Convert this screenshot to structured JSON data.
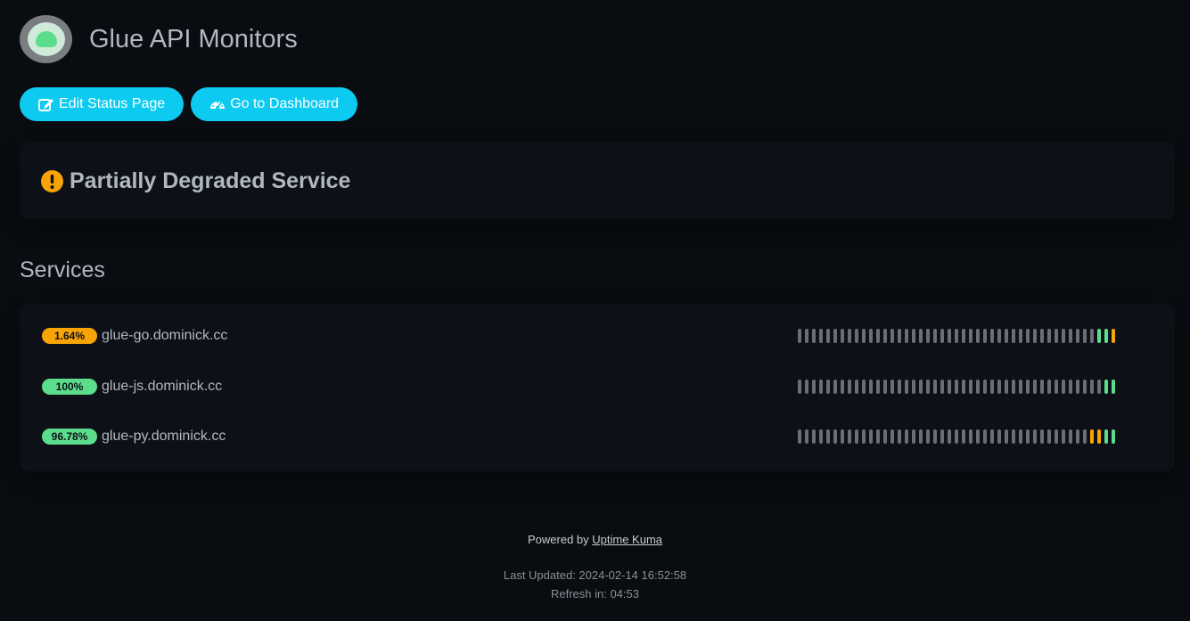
{
  "header": {
    "title": "Glue API Monitors",
    "logo_icon": "uptime-kuma-logo"
  },
  "buttons": {
    "edit_label": "Edit Status Page",
    "dashboard_label": "Go to Dashboard",
    "color": "#0dcaf0"
  },
  "status": {
    "text": "Partially Degraded Service",
    "icon": "exclamation-circle-icon",
    "color": "#f8a306"
  },
  "services": {
    "title": "Services",
    "colors": {
      "up": "#5cdd8b",
      "partial": "#f8a306",
      "empty": "#6a6f75"
    },
    "items": [
      {
        "name": "glue-go.dominick.cc",
        "uptime": "1.64%",
        "badge_color": "#f8a306",
        "beats": [
          "empty",
          "empty",
          "empty",
          "empty",
          "empty",
          "empty",
          "empty",
          "empty",
          "empty",
          "empty",
          "empty",
          "empty",
          "empty",
          "empty",
          "empty",
          "empty",
          "empty",
          "empty",
          "empty",
          "empty",
          "empty",
          "empty",
          "empty",
          "empty",
          "empty",
          "empty",
          "empty",
          "empty",
          "empty",
          "empty",
          "empty",
          "empty",
          "empty",
          "empty",
          "empty",
          "empty",
          "empty",
          "empty",
          "empty",
          "empty",
          "empty",
          "empty",
          "up",
          "up",
          "partial"
        ]
      },
      {
        "name": "glue-js.dominick.cc",
        "uptime": "100%",
        "badge_color": "#5cdd8b",
        "beats": [
          "empty",
          "empty",
          "empty",
          "empty",
          "empty",
          "empty",
          "empty",
          "empty",
          "empty",
          "empty",
          "empty",
          "empty",
          "empty",
          "empty",
          "empty",
          "empty",
          "empty",
          "empty",
          "empty",
          "empty",
          "empty",
          "empty",
          "empty",
          "empty",
          "empty",
          "empty",
          "empty",
          "empty",
          "empty",
          "empty",
          "empty",
          "empty",
          "empty",
          "empty",
          "empty",
          "empty",
          "empty",
          "empty",
          "empty",
          "empty",
          "empty",
          "empty",
          "empty",
          "up",
          "up"
        ]
      },
      {
        "name": "glue-py.dominick.cc",
        "uptime": "96.78%",
        "badge_color": "#5cdd8b",
        "beats": [
          "empty",
          "empty",
          "empty",
          "empty",
          "empty",
          "empty",
          "empty",
          "empty",
          "empty",
          "empty",
          "empty",
          "empty",
          "empty",
          "empty",
          "empty",
          "empty",
          "empty",
          "empty",
          "empty",
          "empty",
          "empty",
          "empty",
          "empty",
          "empty",
          "empty",
          "empty",
          "empty",
          "empty",
          "empty",
          "empty",
          "empty",
          "empty",
          "empty",
          "empty",
          "empty",
          "empty",
          "empty",
          "empty",
          "empty",
          "empty",
          "empty",
          "partial",
          "partial",
          "up",
          "up"
        ]
      }
    ]
  },
  "footer": {
    "powered_prefix": "Powered by",
    "powered_link": "Uptime Kuma",
    "last_updated": "Last Updated: 2024-02-14 16:52:58",
    "refresh": "Refresh in: 04:53"
  }
}
